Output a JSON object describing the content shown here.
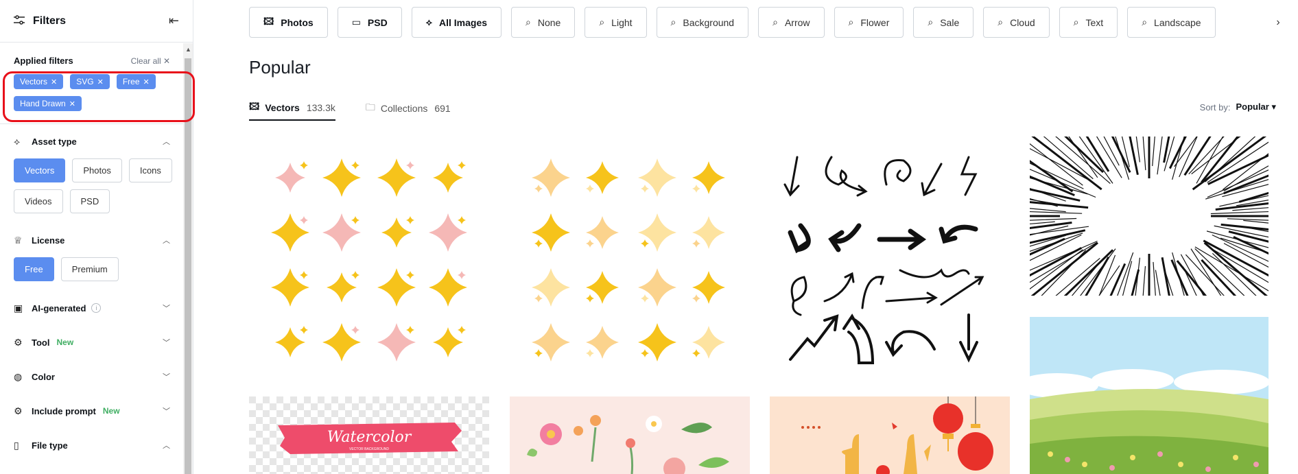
{
  "sidebar": {
    "title": "Filters",
    "applied": {
      "label": "Applied filters",
      "clear_all": "Clear all ✕",
      "chips": [
        "Vectors",
        "SVG",
        "Free",
        "Hand Drawn"
      ]
    },
    "sections": {
      "asset_type": {
        "label": "Asset type",
        "options": [
          "Vectors",
          "Photos",
          "Icons",
          "Videos",
          "PSD"
        ],
        "selected": "Vectors"
      },
      "license": {
        "label": "License",
        "options": [
          "Free",
          "Premium"
        ],
        "selected": "Free"
      },
      "ai_generated": {
        "label": "AI-generated"
      },
      "tool": {
        "label": "Tool",
        "badge": "New"
      },
      "color": {
        "label": "Color"
      },
      "include_prompt": {
        "label": "Include prompt",
        "badge": "New"
      },
      "file_type": {
        "label": "File type"
      }
    }
  },
  "topbar": {
    "items": [
      {
        "label": "Photos",
        "icon": "photo-icon",
        "bold": true
      },
      {
        "label": "PSD",
        "icon": "psd-icon",
        "bold": true
      },
      {
        "label": "All Images",
        "icon": "shapes-icon",
        "bold": true
      },
      {
        "label": "None",
        "icon": "search-icon"
      },
      {
        "label": "Light",
        "icon": "search-icon"
      },
      {
        "label": "Background",
        "icon": "search-icon"
      },
      {
        "label": "Arrow",
        "icon": "search-icon"
      },
      {
        "label": "Flower",
        "icon": "search-icon"
      },
      {
        "label": "Sale",
        "icon": "search-icon"
      },
      {
        "label": "Cloud",
        "icon": "search-icon"
      },
      {
        "label": "Text",
        "icon": "search-icon"
      },
      {
        "label": "Landscape",
        "icon": "search-icon"
      }
    ]
  },
  "main": {
    "title": "Popular",
    "tabs": [
      {
        "label": "Vectors",
        "count": "133.3k",
        "active": true
      },
      {
        "label": "Collections",
        "count": "691",
        "active": false
      }
    ],
    "sort_label": "Sort by:",
    "sort_value": "Popular"
  },
  "cards": {
    "watercolor_text": "Watercolor",
    "watercolor_sub": "VECTOR BACKGROUND"
  },
  "colors": {
    "accent": "#5b8def",
    "highlight": "#e8101a",
    "new_badge": "#3fae62",
    "sparkle_gold": "#f6c31b",
    "sparkle_pink": "#f5b8b6"
  }
}
